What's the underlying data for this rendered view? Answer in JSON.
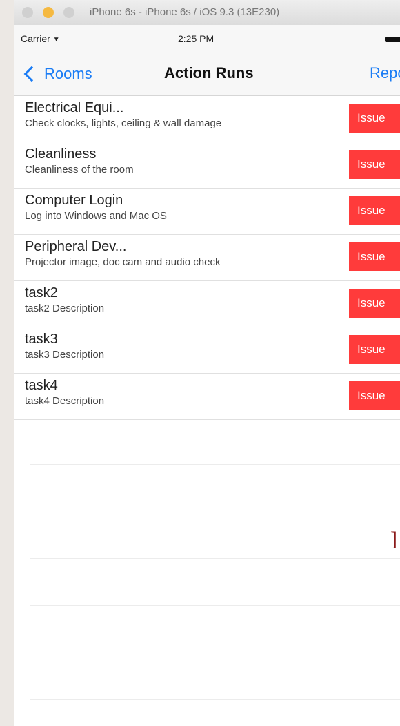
{
  "simulator": {
    "title": "iPhone 6s - iPhone 6s / iOS 9.3 (13E230)"
  },
  "status_bar": {
    "carrier": "Carrier",
    "wifi_icon": "wifi-icon",
    "time": "2:25 PM",
    "battery_icon": "battery-icon"
  },
  "nav": {
    "back_label": "Rooms",
    "title": "Action Runs",
    "right_label": "Report"
  },
  "tasks": [
    {
      "title": "Electrical Equi...",
      "description": "Check clocks, lights, ceiling & wall damage",
      "button": "Issue"
    },
    {
      "title": "Cleanliness",
      "description": "Cleanliness of the room",
      "button": "Issue"
    },
    {
      "title": "Computer Login",
      "description": "Log into Windows and Mac OS",
      "button": "Issue"
    },
    {
      "title": "Peripheral Dev...",
      "description": "Projector image, doc cam and audio check",
      "button": "Issue"
    },
    {
      "title": "task2",
      "description": "task2 Description",
      "button": "Issue"
    },
    {
      "title": "task3",
      "description": "task3 Description",
      "button": "Issue"
    },
    {
      "title": "task4",
      "description": "task4 Description",
      "button": "Issue"
    }
  ],
  "colors": {
    "accent": "#1a7cf5",
    "issue": "#ff3b3b"
  }
}
